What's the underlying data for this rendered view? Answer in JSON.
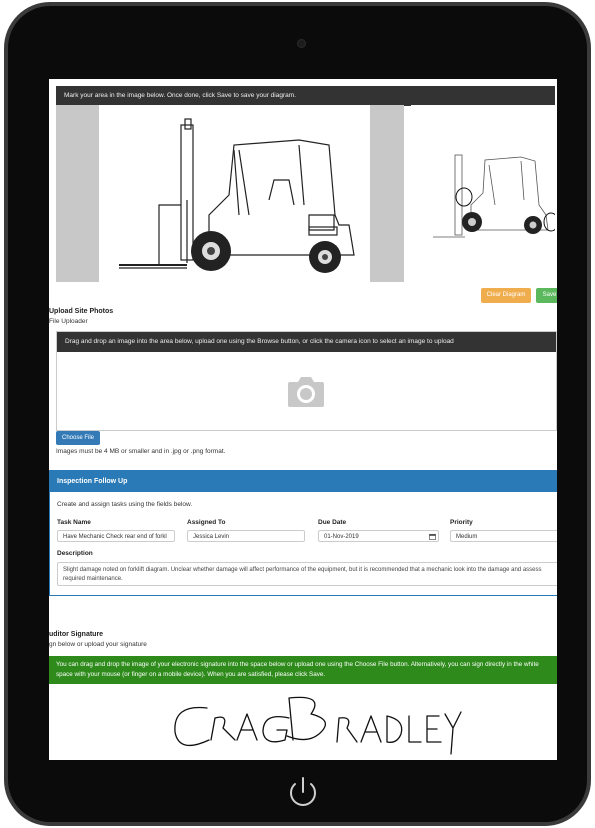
{
  "diagram": {
    "instruction": "Mark your area in the image below. Once done, click Save to save your diagram.",
    "clear_label": "Clear Diagram",
    "save_label": "Save"
  },
  "upload": {
    "title": "Upload Site Photos",
    "subtitle": "File Uploader",
    "instruction": "Drag and drop an image into the area below, upload one using the Browse button, or click the camera icon to select an image to upload",
    "choose_label": "Choose File",
    "note": "Images must be 4 MB or smaller and in .jpg or .png format."
  },
  "followup": {
    "title": "Inspection Follow Up",
    "intro": "Create and assign tasks using the fields below.",
    "task_label": "Task Name",
    "task_value": "Have Mechanic Check rear end of forkl",
    "assigned_label": "Assigned To",
    "assigned_value": "Jessica Levin",
    "due_label": "Due Date",
    "due_value": "01-Nov-2019",
    "priority_label": "Priority",
    "priority_value": "Medium",
    "description_label": "Description",
    "description_value": "Slight damage noted on forklift diagram. Unclear whether damage will affect performance of the equipment, but it is recommended that a mechanic look into the damage and assess required maintenance."
  },
  "signature": {
    "title": "uditor Signature",
    "subtitle": "gn below or upload your signature",
    "instruction": "You can drag and drop the image of your electronic signature into the space below or upload one using the Choose File button. Alternatively, you can sign directly in the white space with your mouse (or finger on a mobile device). When you are satisfied, please click Save.",
    "signed_name": "Craig Bradley"
  },
  "colors": {
    "panel_blue": "#2a7ab8",
    "save_green": "#5cb85c",
    "clear_orange": "#f0ad4e",
    "note_green": "#2e8b1b",
    "choose_blue": "#337ab7"
  },
  "icons": [
    "camera-icon",
    "calendar-icon",
    "power-icon"
  ]
}
